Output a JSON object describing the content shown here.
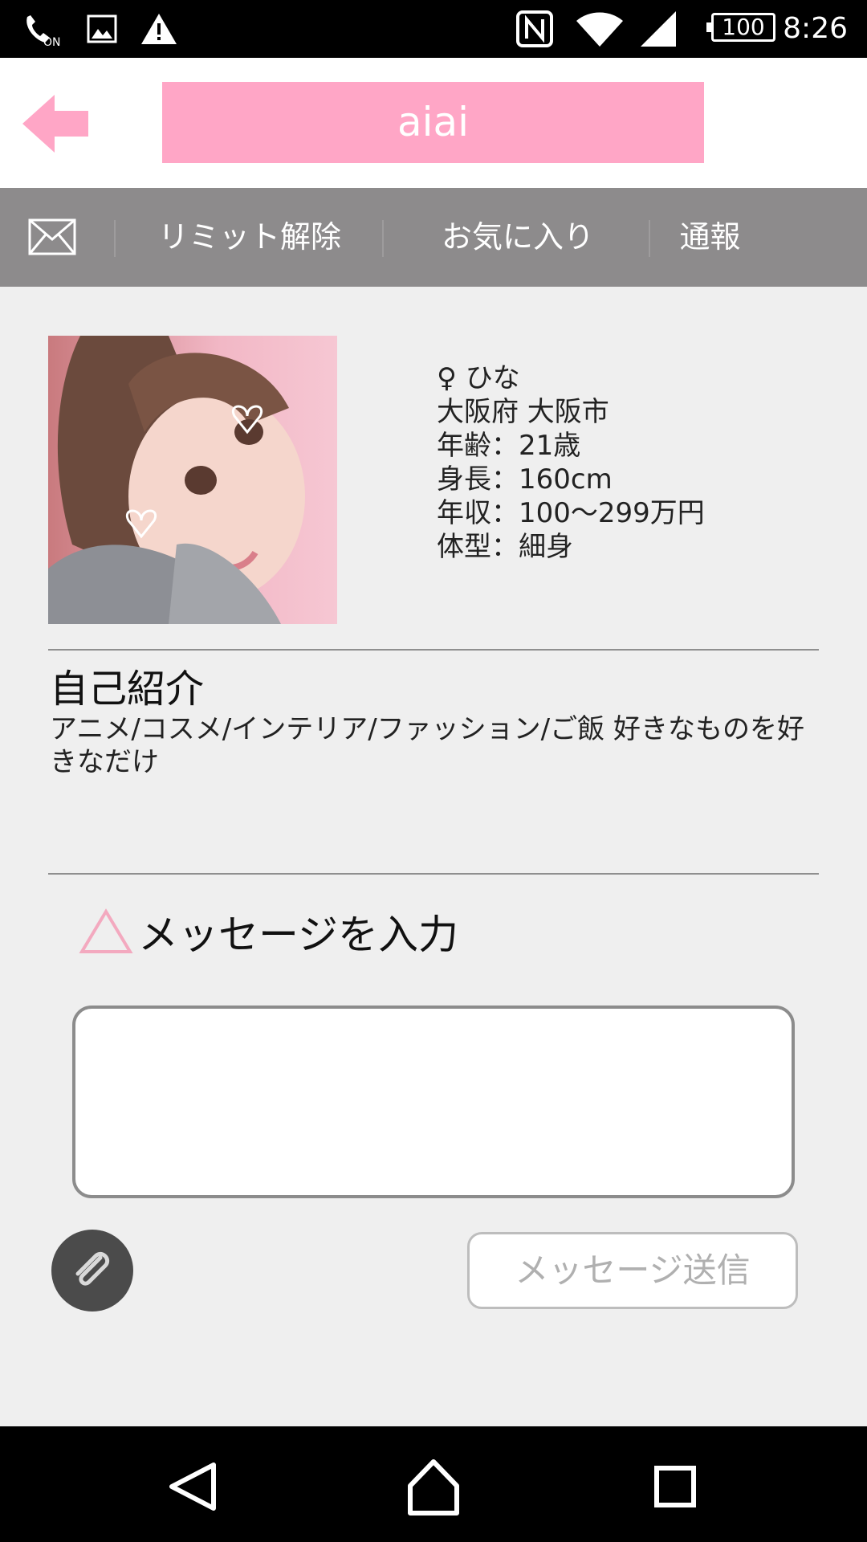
{
  "status_bar": {
    "icons": [
      "nfc-call-icon",
      "image-icon",
      "warning-icon",
      "nfc-n-icon",
      "wifi-icon",
      "signal-icon"
    ],
    "battery": "100",
    "time": "8:26"
  },
  "header": {
    "title": "aiai",
    "accent_color": "#ffa6c6"
  },
  "actions": {
    "mail_icon": "mail-icon",
    "limit_release": "リミット解除",
    "favorite": "お気に入り",
    "report": "通報"
  },
  "profile": {
    "name": "♀ ひな",
    "location": "大阪府 大阪市",
    "age": "年齢：21歳",
    "height": "身長：160cm",
    "income": "年収：100〜299万円",
    "body_type": "体型：細身"
  },
  "intro": {
    "title": "自己紹介",
    "text": "アニメ/コスメ/インテリア/ファッション/ご飯 好きなものを好きなだけ"
  },
  "message": {
    "label": "メッセージを入力",
    "placeholder": "",
    "send_label": "メッセージ送信"
  }
}
